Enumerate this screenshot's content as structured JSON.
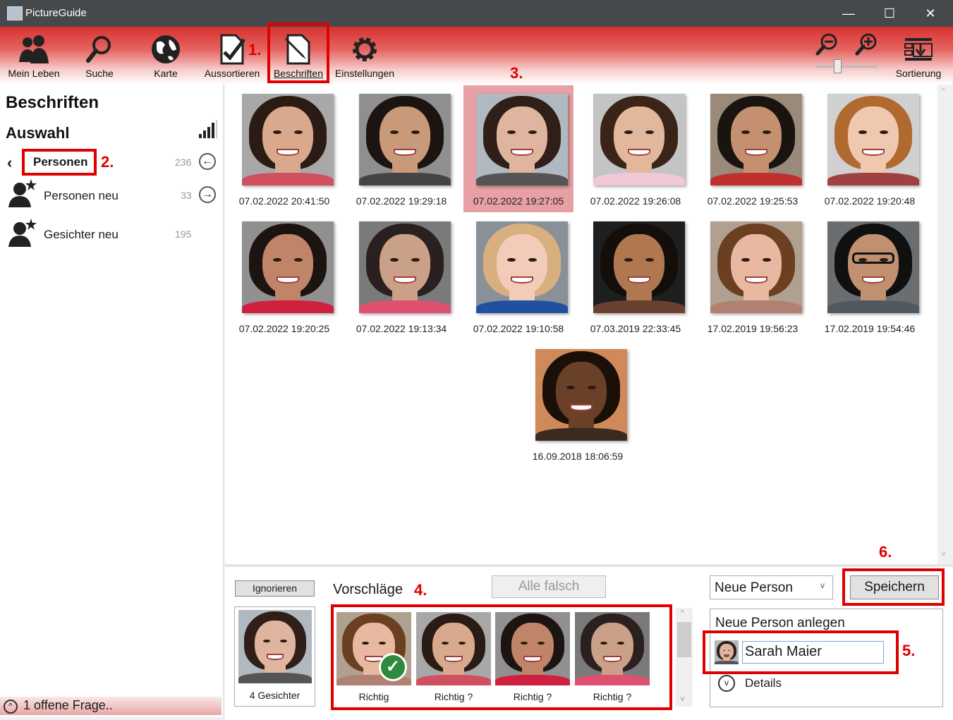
{
  "window": {
    "title": "PictureGuide",
    "minimize": "—",
    "maximize": "☐",
    "close": "✕"
  },
  "toolbar": {
    "mein_leben": "Mein Leben",
    "suche": "Suche",
    "karte": "Karte",
    "aussortieren": "Aussortieren",
    "beschriften": "Beschriften",
    "einstellungen": "Einstellungen",
    "sortierung": "Sortierung",
    "zoom_level": 0.35
  },
  "annotations": {
    "n1": "1.",
    "n2": "2.",
    "n3": "3.",
    "n4": "4.",
    "n5": "5.",
    "n6": "6."
  },
  "sidebar": {
    "title": "Beschriften",
    "section": "Auswahl",
    "back_item": {
      "label": "Personen",
      "count": "236"
    },
    "items": [
      {
        "label": "Personen neu",
        "count": "33"
      },
      {
        "label": "Gesichter neu",
        "count": "195"
      }
    ],
    "open_questions": "1 offene Frage.."
  },
  "photos": [
    {
      "date": "07.02.2022 20:41:50"
    },
    {
      "date": "07.02.2022 19:29:18"
    },
    {
      "date": "07.02.2022 19:27:05",
      "selected": true
    },
    {
      "date": "07.02.2022 19:26:08"
    },
    {
      "date": "07.02.2022 19:25:53"
    },
    {
      "date": "07.02.2022 19:20:48"
    },
    {
      "date": "07.02.2022 19:20:25"
    },
    {
      "date": "07.02.2022 19:13:34"
    },
    {
      "date": "07.02.2022 19:10:58"
    },
    {
      "date": "07.03.2019 22:33:45"
    },
    {
      "date": "17.02.2019 19:56:23"
    },
    {
      "date": "17.02.2019 19:54:46"
    },
    {
      "date": "16.09.2018 18:06:59"
    }
  ],
  "bottom": {
    "ignore_button": "Ignorieren",
    "faces_count": "4 Gesichter",
    "suggestions_title": "Vorschläge",
    "all_wrong_button": "Alle falsch",
    "suggestions": [
      {
        "label": "Richtig"
      },
      {
        "label": "Richtig ?"
      },
      {
        "label": "Richtig ?"
      },
      {
        "label": "Richtig ?"
      }
    ],
    "person_select": "Neue Person",
    "save_button": "Speichern",
    "new_person_title": "Neue Person anlegen",
    "name_value": "Sarah Maier",
    "details": "Details"
  },
  "colors": {
    "accent_red": "#e10000",
    "toolbar_red": "#d7312f",
    "selected_bg": "#e7a0a3",
    "check_green": "#2e8b3d"
  }
}
